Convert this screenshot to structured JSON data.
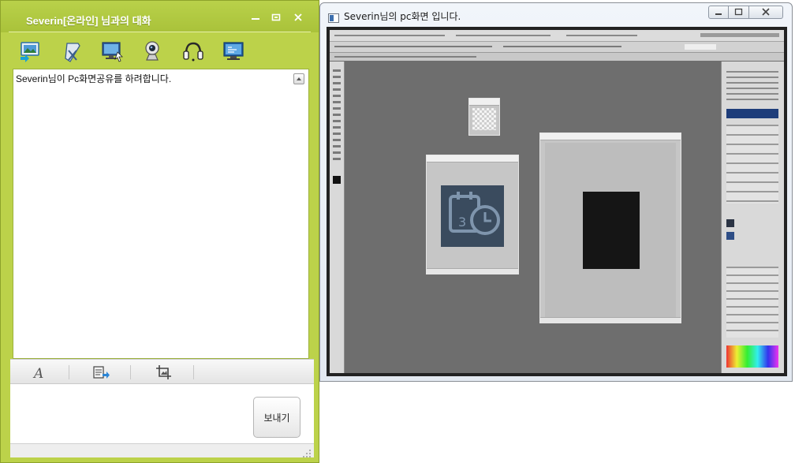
{
  "chat_window": {
    "title": "Severin[온라인] 님과의 대화",
    "controls": [
      "minimize-icon",
      "maximize-icon",
      "close-icon"
    ],
    "toolbar_icons": [
      "share-photo-icon",
      "send-file-icon",
      "screen-share-icon",
      "webcam-icon",
      "headset-icon",
      "remote-desktop-icon"
    ],
    "message": "Severin님이 Pc화면공유를 하려합니다.",
    "format_icons": [
      "font-icon",
      "file-transfer-icon",
      "screen-capture-icon"
    ],
    "send_label": "보내기",
    "colors": {
      "frame": "#bcd24a",
      "title_text": "#ffffff"
    }
  },
  "share_window": {
    "title": "Severin님의 pc화면 입니다.",
    "controls": [
      "minimize-icon",
      "maximize-icon",
      "close-icon"
    ]
  }
}
